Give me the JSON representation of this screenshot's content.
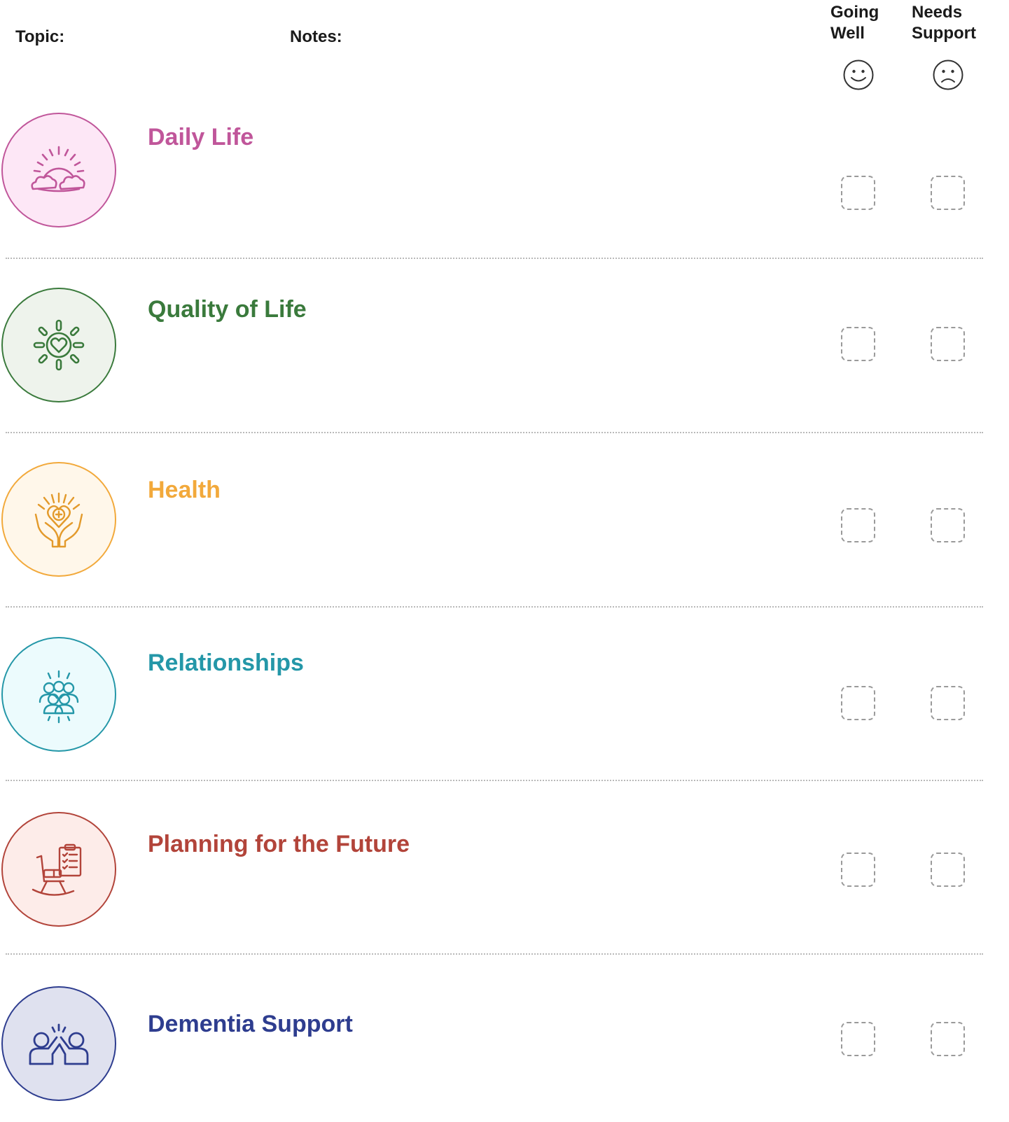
{
  "header": {
    "topic_label": "Topic:",
    "notes_label": "Notes:",
    "going_well_label": "Going Well",
    "needs_support_label": "Needs Support",
    "going_well_icon": "smiley-face-icon",
    "needs_support_icon": "sad-face-icon"
  },
  "topics": [
    {
      "title": "Daily Life",
      "icon": "sun-clouds-icon",
      "color": "#c0569a",
      "fill": "#fde7f6"
    },
    {
      "title": "Quality of Life",
      "icon": "sun-heart-icon",
      "color": "#3a7a3c",
      "fill": "#eef3ec"
    },
    {
      "title": "Health",
      "icon": "hands-heart-icon",
      "color": "#f2a93b",
      "fill": "#fff7ea"
    },
    {
      "title": "Relationships",
      "icon": "group-people-icon",
      "color": "#2497a8",
      "fill": "#ecfbfd"
    },
    {
      "title": "Planning for the Future",
      "icon": "rocking-chair-clipboard-icon",
      "color": "#b2443a",
      "fill": "#fdece9"
    },
    {
      "title": "Dementia Support",
      "icon": "high-five-people-icon",
      "color": "#2e3d8f",
      "fill": "#dfe1ef"
    }
  ]
}
